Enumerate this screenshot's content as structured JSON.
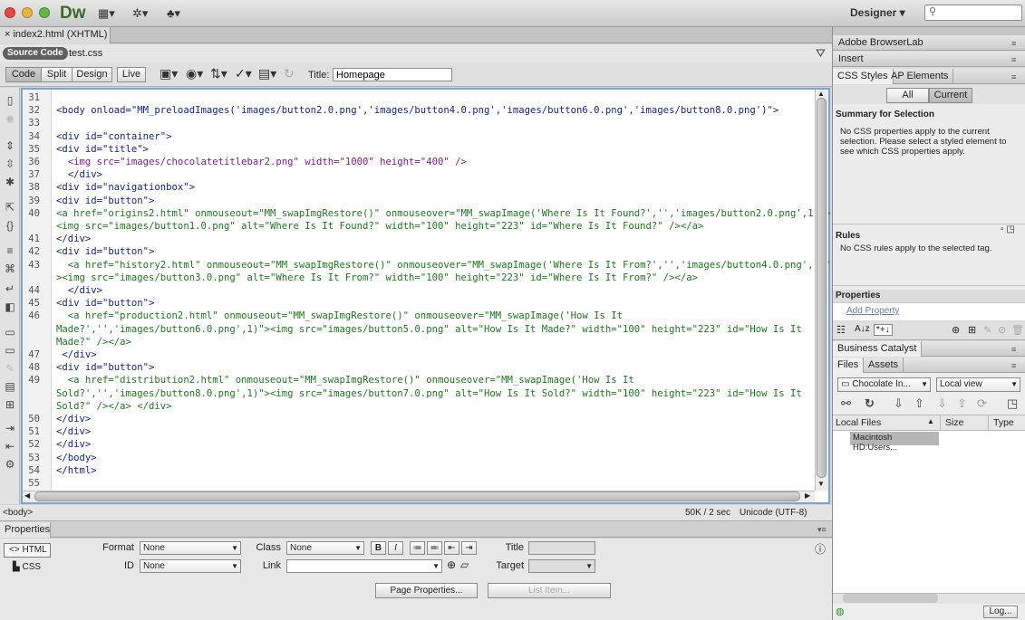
{
  "app": {
    "logo": "Dw",
    "workspace": "Designer ▾",
    "search_placeholder": ""
  },
  "document": {
    "tab": "index2.html (XHTML)",
    "source_code": "Source Code",
    "related_file": "test.css"
  },
  "doc_toolbar": {
    "code": "Code",
    "split": "Split",
    "design": "Design",
    "live": "Live",
    "title_label": "Title:",
    "title_value": "Homepage"
  },
  "code_lines": [
    {
      "n": "31",
      "t": ""
    },
    {
      "n": "32",
      "t": "<body onload=\"MM_preloadImages('images/button2.0.png','images/button4.0.png','images/button6.0.png','images/button8.0.png')\">"
    },
    {
      "n": "33",
      "t": ""
    },
    {
      "n": "34",
      "t": "<div id=\"container\">"
    },
    {
      "n": "35",
      "t": "<div id=\"title\">"
    },
    {
      "n": "36",
      "t": "  <img src=\"images/chocolatetitlebar2.png\" width=\"1000\" height=\"400\" />"
    },
    {
      "n": "37",
      "t": "  </div>"
    },
    {
      "n": "38",
      "t": "<div id=\"navigationbox\">"
    },
    {
      "n": "39",
      "t": "<div id=\"button\">"
    },
    {
      "n": "40",
      "t": "<a href=\"origins2.html\" onmouseout=\"MM_swapImgRestore()\" onmouseover=\"MM_swapImage('Where Is It Found?','','images/button2.0.png',1)\">"
    },
    {
      "n": "",
      "t": "<img src=\"images/button1.0.png\" alt=\"Where Is It Found?\" width=\"100\" height=\"223\" id=\"Where Is It Found?\" /></a>"
    },
    {
      "n": "41",
      "t": "</div>"
    },
    {
      "n": "42",
      "t": "<div id=\"button\">"
    },
    {
      "n": "43",
      "t": "  <a href=\"history2.html\" onmouseout=\"MM_swapImgRestore()\" onmouseover=\"MM_swapImage('Where Is It From?','','images/button4.0.png',1)\""
    },
    {
      "n": "",
      "t": "><img src=\"images/button3.0.png\" alt=\"Where Is It From?\" width=\"100\" height=\"223\" id=\"Where Is It From?\" /></a>"
    },
    {
      "n": "44",
      "t": "  </div>"
    },
    {
      "n": "45",
      "t": "<div id=\"button\">"
    },
    {
      "n": "46",
      "t": "  <a href=\"production2.html\" onmouseout=\"MM_swapImgRestore()\" onmouseover=\"MM_swapImage('How Is It"
    },
    {
      "n": "",
      "t": "Made?','','images/button6.0.png',1)\"><img src=\"images/button5.0.png\" alt=\"How Is It Made?\" width=\"100\" height=\"223\" id=\"How Is It"
    },
    {
      "n": "",
      "t": "Made?\" /></a>"
    },
    {
      "n": "47",
      "t": " </div>"
    },
    {
      "n": "48",
      "t": "<div id=\"button\">"
    },
    {
      "n": "49",
      "t": "  <a href=\"distribution2.html\" onmouseout=\"MM_swapImgRestore()\" onmouseover=\"MM_swapImage('How Is It"
    },
    {
      "n": "",
      "t": "Sold?','','images/button8.0.png',1)\"><img src=\"images/button7.0.png\" alt=\"How Is It Sold?\" width=\"100\" height=\"223\" id=\"How Is It"
    },
    {
      "n": "",
      "t": "Sold?\" /></a> </div>"
    },
    {
      "n": "50",
      "t": "</div>"
    },
    {
      "n": "51",
      "t": "</div>"
    },
    {
      "n": "52",
      "t": "</div>"
    },
    {
      "n": "53",
      "t": "</body>"
    },
    {
      "n": "54",
      "t": "</html>"
    },
    {
      "n": "55",
      "t": ""
    }
  ],
  "status": {
    "tag": "<body>",
    "size": "50K / 2 sec",
    "encoding": "Unicode (UTF-8)"
  },
  "properties": {
    "tab": "Properties",
    "html": "HTML",
    "css": "CSS",
    "format_label": "Format",
    "format_value": "None",
    "class_label": "Class",
    "class_value": "None",
    "id_label": "ID",
    "id_value": "None",
    "link_label": "Link",
    "link_value": "",
    "title_label": "Title",
    "target_label": "Target",
    "bold": "B",
    "italic": "I",
    "page_properties": "Page Properties...",
    "list_item": "List Item..."
  },
  "right_panel": {
    "browserlab": "Adobe BrowserLab",
    "insert": "Insert",
    "css_styles_tab": "CSS Styles",
    "ap_elements_tab": "AP Elements",
    "all": "All",
    "current": "Current",
    "summary_title": "Summary for Selection",
    "summary_text_1": "No CSS properties apply to the current",
    "summary_text_2": "selection.  Please select a styled element to",
    "summary_text_3": "see which CSS properties apply.",
    "rules_title": "Rules",
    "rules_text": "No CSS rules apply to the selected tag.",
    "properties_title": "Properties",
    "add_property": "Add Property",
    "business_catalyst": "Business Catalyst",
    "files_tab": "Files",
    "assets_tab": "Assets",
    "site_select": "Chocolate In...",
    "view_select": "Local view",
    "col_local": "Local Files",
    "col_size": "Size",
    "col_type": "Type",
    "file_item": "Macintosh HD:Users...",
    "log": "Log..."
  },
  "colors": {
    "accent_border": "#7aa3d6",
    "code_blue": "#11268f",
    "code_green": "#1b7a1b"
  }
}
